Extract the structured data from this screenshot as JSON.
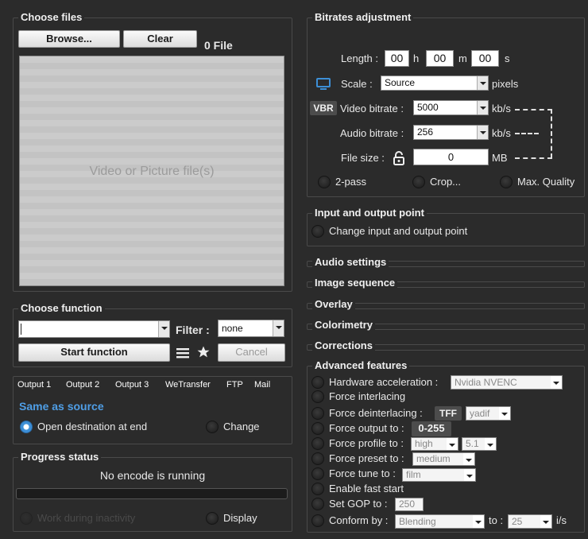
{
  "choose_files": {
    "title": "Choose files",
    "browse_label": "Browse...",
    "clear_label": "Clear",
    "file_count": "0 File",
    "dropzone_text": "Video or Picture file(s)"
  },
  "choose_function": {
    "title": "Choose function",
    "function_value": "",
    "filter_label": "Filter :",
    "filter_value": "none",
    "start_label": "Start function",
    "cancel_label": "Cancel"
  },
  "output": {
    "tabs": [
      "Output 1",
      "Output 2",
      "Output 3",
      "WeTransfer",
      "FTP",
      "Mail"
    ],
    "destination": "Same as source",
    "open_dest_label": "Open destination at end",
    "change_label": "Change"
  },
  "progress": {
    "title": "Progress status",
    "status": "No encode is running",
    "progress_fraction": 0,
    "work_inactivity_label": "Work during inactivity",
    "display_label": "Display"
  },
  "bitrates": {
    "title": "Bitrates adjustment",
    "length_label": "Length :",
    "hours": "00",
    "h": "h",
    "minutes": "00",
    "m": "m",
    "seconds": "00",
    "s": "s",
    "scale_label": "Scale :",
    "scale_value": "Source",
    "pixels": "pixels",
    "vbr": "VBR",
    "video_bitrate_label": "Video bitrate :",
    "video_bitrate_value": "5000",
    "kbs": "kb/s",
    "audio_bitrate_label": "Audio bitrate :",
    "audio_bitrate_value": "256",
    "file_size_label": "File size :",
    "file_size_value": "0",
    "mb": "MB",
    "two_pass_label": "2-pass",
    "crop_label": "Crop...",
    "max_quality_label": "Max. Quality"
  },
  "io_point": {
    "title": "Input and output point",
    "change_label": "Change input and output point"
  },
  "sections": {
    "audio": "Audio settings",
    "image_sequence": "Image sequence",
    "overlay": "Overlay",
    "colorimetry": "Colorimetry",
    "corrections": "Corrections"
  },
  "advanced": {
    "title": "Advanced features",
    "hw_label": "Hardware acceleration :",
    "hw_value": "Nvidia NVENC",
    "interlacing_label": "Force interlacing",
    "deinterlacing_label": "Force deinterlacing :",
    "tff": "TFF",
    "deint_value": "yadif",
    "output_label": "Force output to :",
    "output_range": "0-255",
    "profile_label": "Force profile to :",
    "profile_value": "high",
    "level_value": "5.1",
    "preset_label": "Force preset to :",
    "preset_value": "medium",
    "tune_label": "Force tune to :",
    "tune_value": "film",
    "fast_start_label": "Enable fast start",
    "gop_label": "Set GOP to :",
    "gop_value": "250",
    "conform_label": "Conform by :",
    "conform_value": "Blending",
    "to_label": "to :",
    "fps_value": "25",
    "fps_unit": "i/s"
  },
  "colors": {
    "accent": "#3d8fd6",
    "background": "#2b2b2b"
  }
}
